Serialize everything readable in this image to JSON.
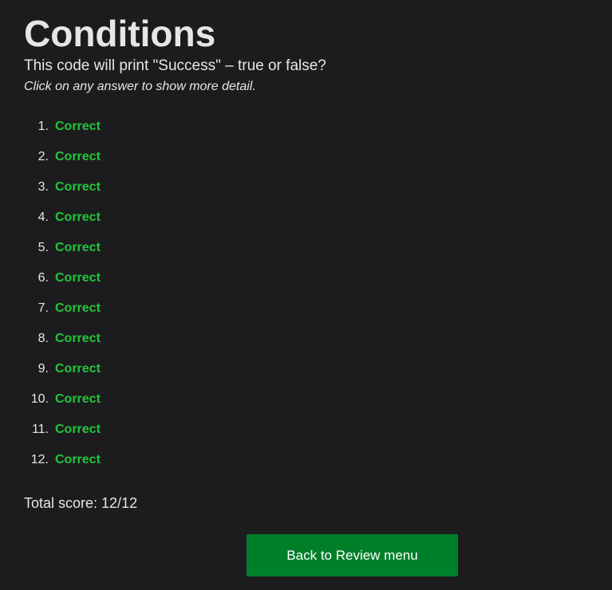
{
  "header": {
    "title": "Conditions",
    "subtitle": "This code will print \"Success\" – true or false?",
    "hint": "Click on any answer to show more detail."
  },
  "answers": [
    {
      "number": "1.",
      "result": "Correct"
    },
    {
      "number": "2.",
      "result": "Correct"
    },
    {
      "number": "3.",
      "result": "Correct"
    },
    {
      "number": "4.",
      "result": "Correct"
    },
    {
      "number": "5.",
      "result": "Correct"
    },
    {
      "number": "6.",
      "result": "Correct"
    },
    {
      "number": "7.",
      "result": "Correct"
    },
    {
      "number": "8.",
      "result": "Correct"
    },
    {
      "number": "9.",
      "result": "Correct"
    },
    {
      "number": "10.",
      "result": "Correct"
    },
    {
      "number": "11.",
      "result": "Correct"
    },
    {
      "number": "12.",
      "result": "Correct"
    }
  ],
  "score": {
    "text": "Total score: 12/12"
  },
  "actions": {
    "back_label": "Back to Review menu"
  },
  "colors": {
    "background": "#1c1c1e",
    "correct": "#22c53b",
    "button": "#007f2a"
  }
}
